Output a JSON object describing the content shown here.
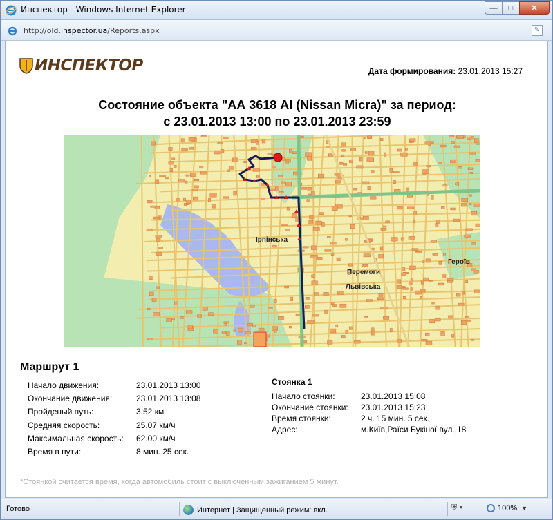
{
  "window": {
    "title": "Инспектор - Windows Internet Explorer",
    "url_prefix": "http://old.",
    "url_domain": "inspector.ua",
    "url_path": "/Reports.aspx"
  },
  "report": {
    "logo_text": "ИНСПЕКТОР",
    "gen_date_label": "Дата формирования:",
    "gen_date_value": "23.01.2013 15:27",
    "title_line1": "Состояние объекта \"АА 3618 АІ (Nissan Micra)\" за период:",
    "title_line2": "с 23.01.2013 13:00 по 23.01.2013 23:59"
  },
  "map": {
    "labels": [
      "Ірпінська",
      "Героїв",
      "Перемоги",
      "Львівська"
    ]
  },
  "route": {
    "title": "Маршрут 1",
    "rows": [
      {
        "k": "Начало движения:",
        "v": "23.01.2013 13:00"
      },
      {
        "k": "Окончание движения:",
        "v": "23.01.2013 13:08"
      },
      {
        "k": "Пройденый путь:",
        "v": "3.52 км"
      },
      {
        "k": "Средняя скорость:",
        "v": "25.07 км/ч"
      },
      {
        "k": "Максимальная скорость:",
        "v": "62.00 км/ч"
      },
      {
        "k": "Время в пути:",
        "v": "8 мин. 25 сек."
      }
    ]
  },
  "parking": {
    "title": "Стоянка 1",
    "rows": [
      {
        "k": "Начало стоянки:",
        "v": "23.01.2013 15:08"
      },
      {
        "k": "Окончание стоянки:",
        "v": "23.01.2013 15:23"
      },
      {
        "k": "Время стоянки:",
        "v": "2 ч. 15 мин. 5 сек."
      },
      {
        "k": "Адрес:",
        "v": "м.Київ,Раїси Букіної вул.,18"
      }
    ]
  },
  "note": "*Стоянкой считается время, когда автомобиль стоит с выключенным зажиганием 5 минут.",
  "statusbar": {
    "ready": "Готово",
    "zone": "Интернет | Защищенный режим: вкл.",
    "zoom": "100%"
  },
  "colors": {
    "route_line": "#1a1a5a",
    "route_marker": "#e01818",
    "map_base": "#f3edb0",
    "map_green": "#b7e3b5",
    "map_water": "#a9b8ee",
    "map_building": "#f0a360"
  }
}
